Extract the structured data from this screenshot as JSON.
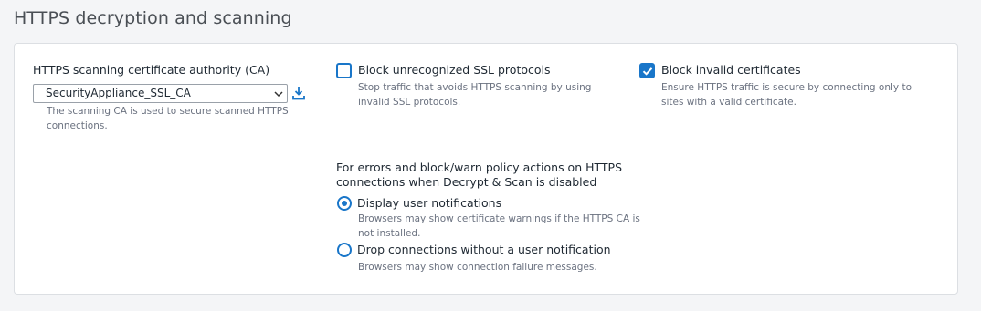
{
  "section": {
    "title": "HTTPS decryption and scanning"
  },
  "ca": {
    "label": "HTTPS scanning certificate authority (CA)",
    "selected": "SecurityAppliance_SSL_CA",
    "help": "The scanning CA is used to secure scanned HTTPS connections.",
    "download_icon": "download-icon"
  },
  "block_unrecognized": {
    "label": "Block unrecognized SSL protocols",
    "checked": false,
    "help": "Stop traffic that avoids HTTPS scanning by using invalid SSL protocols."
  },
  "block_invalid": {
    "label": "Block invalid certificates",
    "checked": true,
    "help": "Ensure HTTPS traffic is secure by connecting only to sites with a valid certificate."
  },
  "policy": {
    "label": "For errors and block/warn policy actions on HTTPS connections when Decrypt & Scan is disabled",
    "options": [
      {
        "label": "Display user notifications",
        "selected": true,
        "help": "Browsers may show certificate warnings if the HTTPS CA is not installed."
      },
      {
        "label": "Drop connections without a user notification",
        "selected": false,
        "help": "Browsers may show connection failure messages."
      }
    ]
  },
  "colors": {
    "accent": "#1976c9",
    "help_text": "#6b7280",
    "border": "#dcdfe3"
  }
}
